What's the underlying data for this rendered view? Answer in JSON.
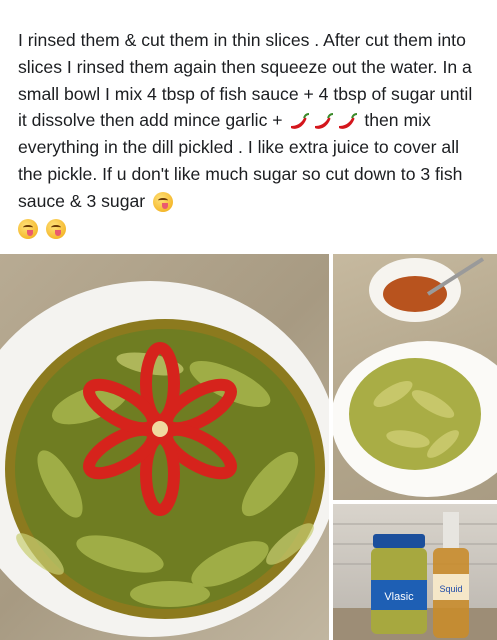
{
  "post": {
    "paragraph_before_peppers": "I rinsed them & cut them in thin slices .  After cut them into slices I rinsed them again then squeeze out the water. In a small bowl I mix 4 tbsp of fish sauce + 4 tbsp of sugar until it dissolve then add mince garlic +",
    "paragraph_after_peppers": "then mix everything in the dill pickled .  I like extra juice to cover all the pickle.  If u don't like much sugar so cut down to 3 fish sauce  & 3 sugar",
    "emojis": [
      "hot-pepper-icon",
      "hot-pepper-icon",
      "hot-pepper-icon",
      "yum-face-icon",
      "yum-face-icon",
      "yum-face-icon"
    ]
  },
  "photos": {
    "main": "dill pickle salad with sliced red chili",
    "side_top": "plate of sliced pickles with bowl of sauce",
    "side_bottom": "jar of pickles and bottle of fish sauce",
    "jar_label": "Vlasic",
    "bottle_label": "Squid"
  }
}
